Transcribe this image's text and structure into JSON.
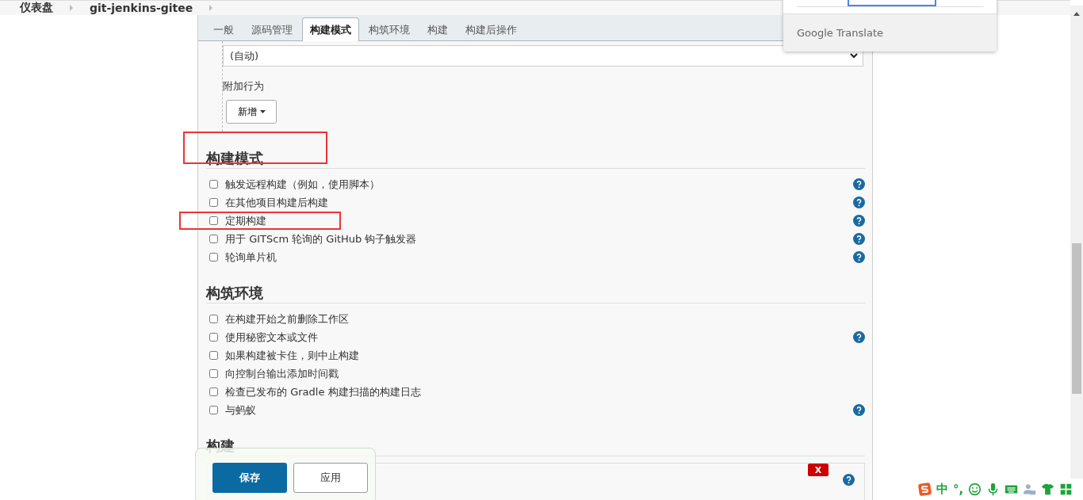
{
  "breadcrumb": [
    {
      "label": "仪表盘"
    },
    {
      "label": "git-jenkins-gitee"
    }
  ],
  "tabs": [
    {
      "label": "一般",
      "selected": false
    },
    {
      "label": "源码管理",
      "selected": false
    },
    {
      "label": "构建模式",
      "selected": true
    },
    {
      "label": "构筑环境",
      "selected": false
    },
    {
      "label": "构建",
      "selected": false
    },
    {
      "label": "构建后操作",
      "selected": false
    }
  ],
  "scm": {
    "select_value": "(自动)",
    "additional_label": "附加行为",
    "add_button": "新增"
  },
  "sections": [
    {
      "title": "构建模式",
      "highlighted": true,
      "options": [
        {
          "label": "触发远程构建（例如，使用脚本）",
          "checked": false,
          "help": true,
          "highlighted": false
        },
        {
          "label": "在其他项目构建后构建",
          "checked": false,
          "help": true,
          "highlighted": false
        },
        {
          "label": "定期构建",
          "checked": false,
          "help": true,
          "highlighted": true
        },
        {
          "label": "用于 GITScm 轮询的 GitHub 钩子触发器",
          "checked": false,
          "help": true,
          "highlighted": false
        },
        {
          "label": "轮询单片机",
          "checked": false,
          "help": true,
          "highlighted": false
        }
      ]
    },
    {
      "title": "构筑环境",
      "highlighted": false,
      "options": [
        {
          "label": "在构建开始之前删除工作区",
          "checked": false,
          "help": false,
          "highlighted": false
        },
        {
          "label": "使用秘密文本或文件",
          "checked": false,
          "help": true,
          "highlighted": false
        },
        {
          "label": "如果构建被卡住，则中止构建",
          "checked": false,
          "help": false,
          "highlighted": false
        },
        {
          "label": "向控制台输出添加时间戳",
          "checked": false,
          "help": false,
          "highlighted": false
        },
        {
          "label": "检查已发布的 Gradle 构建扫描的构建日志",
          "checked": false,
          "help": false,
          "highlighted": false
        },
        {
          "label": "与蚂蚁",
          "checked": false,
          "help": true,
          "highlighted": false
        }
      ]
    },
    {
      "title": "构建",
      "highlighted": false
    }
  ],
  "build_step": {
    "delete_button": "X"
  },
  "footer": {
    "save_button": "保存",
    "apply_button": "应用"
  },
  "translate_popup": {
    "brand": "Google",
    "product": "Translate"
  },
  "ime_toolbar": {
    "mode": "中",
    "punctuation": "°,"
  }
}
